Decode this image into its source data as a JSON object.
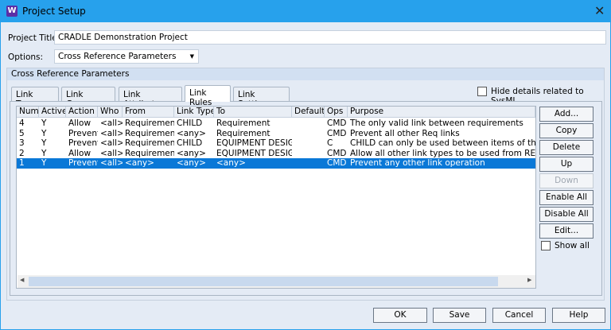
{
  "window": {
    "title": "Project Setup",
    "app_icon": "W",
    "close": "✕"
  },
  "form": {
    "title_label": "Project Title:",
    "title_value": "CRADLE Demonstration Project",
    "options_label": "Options:",
    "options_value": "Cross Reference Parameters"
  },
  "group": {
    "title": "Cross Reference Parameters",
    "tabs": [
      "Link Types",
      "Link Groups",
      "Link Attributes",
      "Link Rules",
      "Link Settings"
    ],
    "selected_tab": "Link Rules",
    "hide_sysml_label": "Hide details related to SysML",
    "hide_sysml_checked": false
  },
  "grid": {
    "columns": [
      "Num",
      "Active",
      "Action",
      "Who",
      "From",
      "Link Type",
      "To",
      "Default",
      "Ops",
      "Purpose"
    ],
    "rows": [
      [
        "4",
        "Y",
        "Allow",
        "<all>",
        "Requirement",
        "CHILD",
        "Requirement",
        "",
        "CMD",
        "The only valid link between requirements"
      ],
      [
        "5",
        "Y",
        "Prevent",
        "<all>",
        "Requirement",
        "<any>",
        "Requirement",
        "",
        "CMD",
        "Prevent all other Req links"
      ],
      [
        "3",
        "Y",
        "Prevent",
        "<all>",
        "Requirement",
        "CHILD",
        "EQUIPMENT DESIGN",
        "",
        "C",
        "CHILD can only be used between items of the same"
      ],
      [
        "2",
        "Y",
        "Allow",
        "<all>",
        "Requirement",
        "<any>",
        "EQUIPMENT DESIGN",
        "",
        "CMD",
        "Allow all other link types to be used from REQ to E"
      ],
      [
        "1",
        "Y",
        "Prevent",
        "<all>",
        "<any>",
        "<any>",
        "<any>",
        "",
        "CMD",
        "Prevent any other link operation"
      ]
    ],
    "selected_row": 4
  },
  "side_buttons": [
    {
      "label": "Add...",
      "enabled": true
    },
    {
      "label": "Copy",
      "enabled": true
    },
    {
      "label": "Delete",
      "enabled": true
    },
    {
      "label": "Up",
      "enabled": true
    },
    {
      "label": "Down",
      "enabled": false
    },
    {
      "label": "Enable All",
      "enabled": true
    },
    {
      "label": "Disable All",
      "enabled": true
    },
    {
      "label": "Edit...",
      "enabled": true
    }
  ],
  "show_all_label": "Show all",
  "show_all_checked": false,
  "footer": {
    "ok": "OK",
    "save": "Save",
    "cancel": "Cancel",
    "help": "Help"
  },
  "colors": {
    "titlebar": "#27a1ec",
    "selection": "#0a78d7"
  }
}
